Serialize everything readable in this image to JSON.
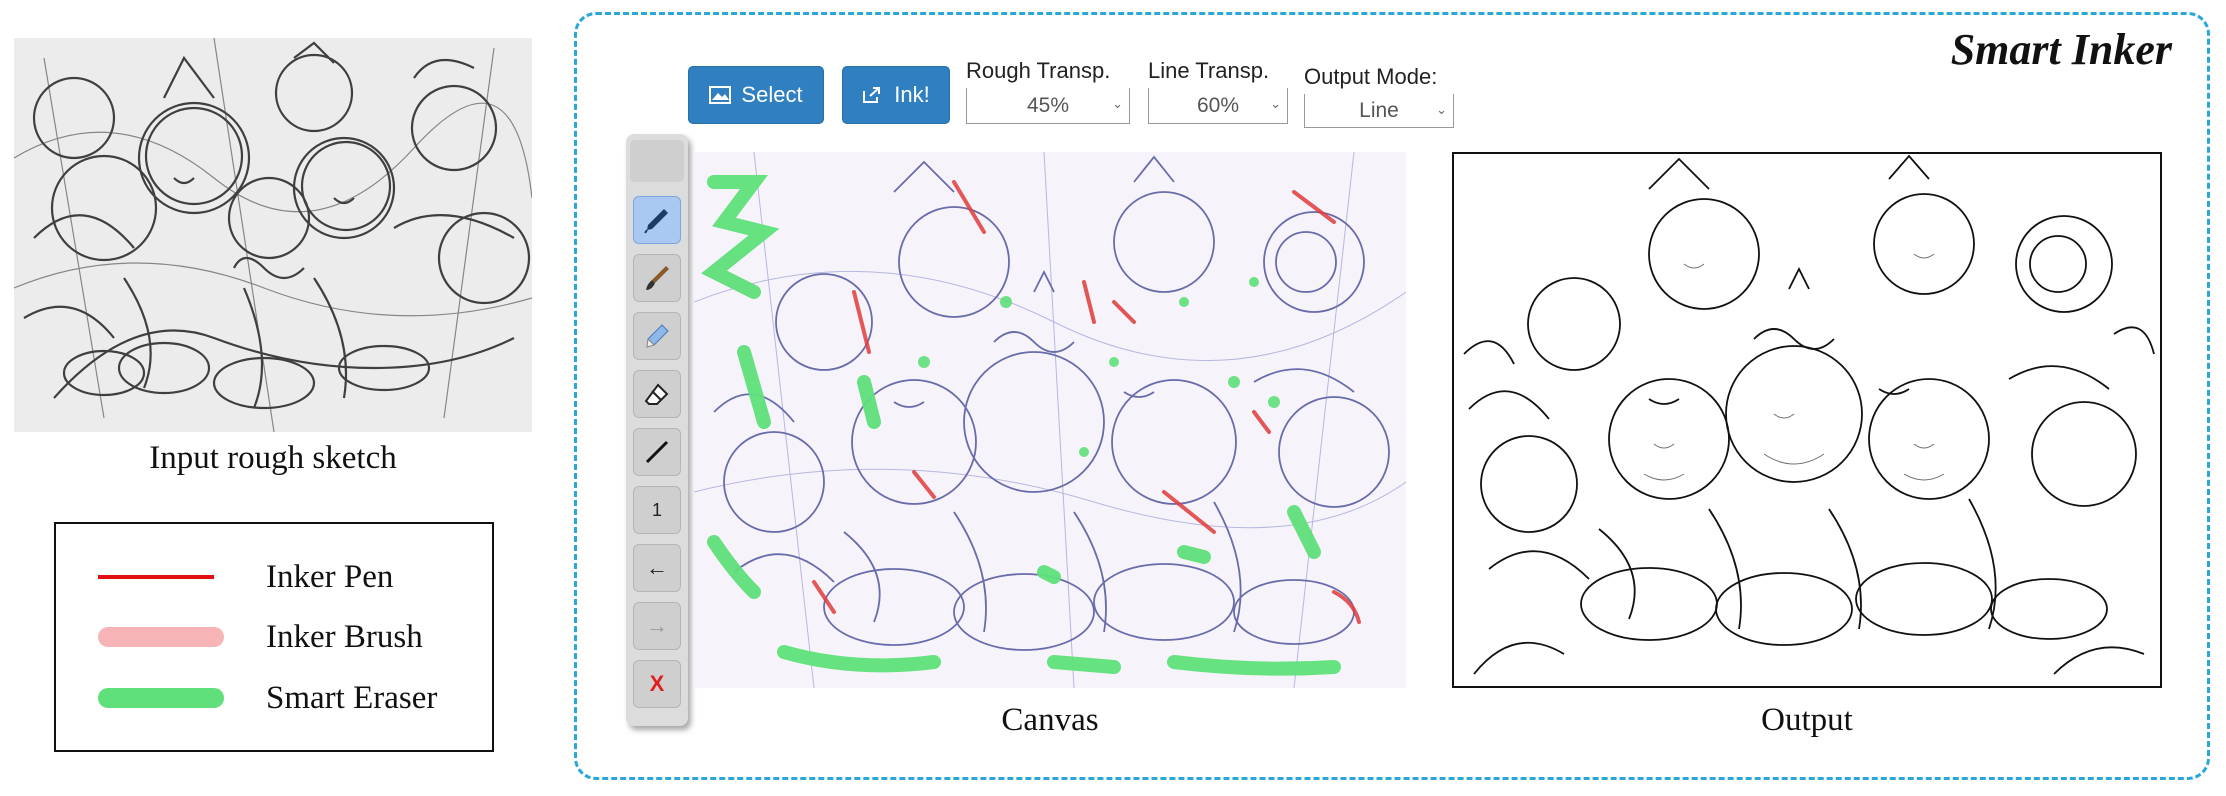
{
  "input": {
    "caption": "Input rough sketch"
  },
  "legend": {
    "items": [
      {
        "label": "Inker Pen",
        "color": "#e01010",
        "style": "thin"
      },
      {
        "label": "Inker Brush",
        "color": "#f7b4b6",
        "style": "thick"
      },
      {
        "label": "Smart Eraser",
        "color": "#5fe07a",
        "style": "thick"
      }
    ]
  },
  "app": {
    "title": "Smart Inker",
    "toolbar": {
      "select_label": "Select",
      "ink_label": "Ink!",
      "rough_transp": {
        "label": "Rough Transp.",
        "value": "45%"
      },
      "line_transp": {
        "label": "Line Transp.",
        "value": "60%"
      },
      "output_mode": {
        "label": "Output Mode:",
        "value": "Line"
      }
    },
    "palette": {
      "tools": [
        {
          "name": "inker-pen-tool",
          "icon": "pen-icon",
          "active": true
        },
        {
          "name": "inker-brush-tool",
          "icon": "brush-icon",
          "active": false
        },
        {
          "name": "smart-eraser-tool",
          "icon": "marker-icon",
          "active": false
        },
        {
          "name": "eraser-tool",
          "icon": "eraser-icon",
          "active": false
        },
        {
          "name": "line-tool",
          "icon": "line-icon",
          "active": false
        },
        {
          "name": "size-tool",
          "icon": "size-icon",
          "label": "1",
          "active": false
        },
        {
          "name": "undo-tool",
          "icon": "arrow-left-icon",
          "label": "←",
          "active": false
        },
        {
          "name": "redo-tool",
          "icon": "arrow-right-icon",
          "label": "→",
          "active": false
        },
        {
          "name": "clear-tool",
          "icon": "close-icon",
          "label": "X",
          "active": false
        }
      ]
    },
    "canvas_caption": "Canvas",
    "output_caption": "Output"
  },
  "colors": {
    "accent": "#2f7fc1",
    "frame": "#2aa7d8"
  }
}
